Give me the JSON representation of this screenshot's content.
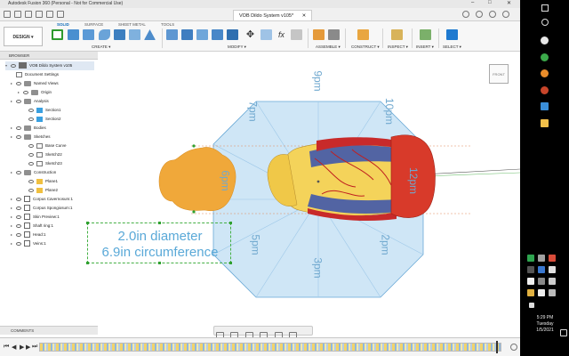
{
  "titlebar": {
    "app_title": "Autodesk Fusion 360 (Personal - Not for Commercial Use)",
    "minimize": "–",
    "maximize": "□",
    "close": "✕"
  },
  "document_tab": {
    "title": "VOB Dildo System v105*",
    "close": "✕"
  },
  "ribbon": {
    "workspace_button": "DESIGN ▾",
    "tabs": [
      "SOLID",
      "SURFACE",
      "SHEET METAL",
      "TOOLS"
    ],
    "active_tab": "SOLID",
    "groups": [
      "CREATE ▾",
      "MODIFY ▾",
      "ASSEMBLE ▾",
      "CONSTRUCT ▾",
      "INSPECT ▾",
      "INSERT ▾",
      "SELECT ▾"
    ]
  },
  "browser": {
    "header": "BROWSER",
    "root": "VOB Dildo System v105",
    "items": [
      {
        "label": "Document Settings",
        "icon": "gear-icon"
      },
      {
        "label": "Named Views",
        "icon": "folder-icon"
      },
      {
        "label": "Origin",
        "icon": "folder-icon"
      },
      {
        "label": "Analysis",
        "icon": "folder-icon"
      },
      {
        "label": "Section1",
        "icon": "section-icon"
      },
      {
        "label": "Section2",
        "icon": "section-icon"
      },
      {
        "label": "Bodies",
        "icon": "folder-icon"
      },
      {
        "label": "Sketches",
        "icon": "folder-icon"
      },
      {
        "label": "Base Curve",
        "icon": "sketch-icon"
      },
      {
        "label": "Sketch22",
        "icon": "sketch-icon"
      },
      {
        "label": "Sketch23",
        "icon": "sketch-icon"
      },
      {
        "label": "Construction",
        "icon": "folder-icon"
      },
      {
        "label": "Plane1",
        "icon": "plane-icon"
      },
      {
        "label": "Plane2",
        "icon": "plane-icon"
      },
      {
        "label": "Corpus Cavernosum:1",
        "icon": "component-icon"
      },
      {
        "label": "Corpus Spongiosum:1",
        "icon": "component-icon"
      },
      {
        "label": "Skin Preview:1",
        "icon": "component-icon"
      },
      {
        "label": "Shaft ring:1",
        "icon": "component-icon"
      },
      {
        "label": "Head:1",
        "icon": "component-icon"
      },
      {
        "label": "Veins:1",
        "icon": "component-icon"
      }
    ]
  },
  "comments_label": "COMMENTS",
  "viewcube_label": "FRONT",
  "canvas": {
    "clock_labels": [
      "9pm",
      "7pm",
      "10pm",
      "6pm",
      "12pm",
      "5pm",
      "2pm",
      "3pm"
    ],
    "annotation_lines": [
      "2.0in diameter",
      "6.9in circumference"
    ]
  },
  "timeline": {
    "controls": [
      "⏮",
      "◀",
      "▶",
      "▶",
      "⏭"
    ]
  },
  "taskbar": {
    "time": "5:29 PM",
    "day": "Tuesday",
    "date": "1/5/2021"
  },
  "colors": {
    "accent": "#0a69b8",
    "sketch_blue": "#6fa8cf",
    "octagon_fill": "#cfe6f6",
    "shape_orange": "#f0a83a",
    "annotation_green": "#45b045"
  }
}
